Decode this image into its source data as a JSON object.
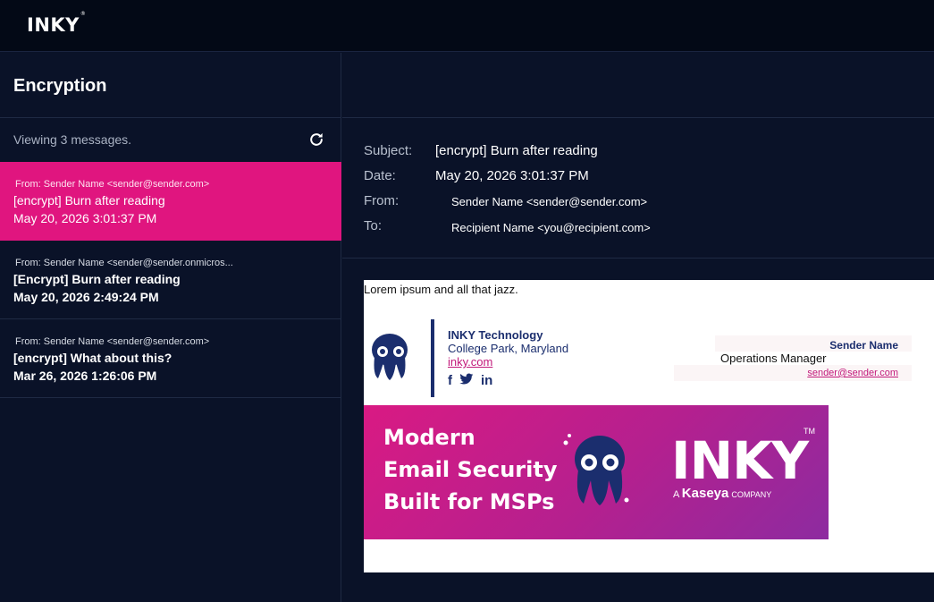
{
  "app": {
    "logo": "INKY",
    "logo_mark": "®"
  },
  "sidebar": {
    "title": "Encryption",
    "viewing_text": "Viewing 3 messages.",
    "refresh_icon": "refresh-icon",
    "messages": [
      {
        "from": "From: Sender Name <sender@sender.com>",
        "subject": "[encrypt] Burn after reading",
        "date": "May 20, 2026 3:01:37 PM",
        "selected": true
      },
      {
        "from": "From: Sender Name <sender@sender.onmicros...",
        "subject": "[Encrypt] Burn after reading",
        "date": "May 20, 2026 2:49:24 PM",
        "selected": false
      },
      {
        "from": "From: Sender Name <sender@sender.com>",
        "subject": "[encrypt] What about this?",
        "date": "Mar 26, 2026 1:26:06 PM",
        "selected": false
      }
    ]
  },
  "detail": {
    "subject_label": "Subject:",
    "subject": "[encrypt] Burn after reading",
    "date_label": "Date:",
    "date": "May 20, 2026 3:01:37 PM",
    "from_label": "From:",
    "from": "Sender Name <sender@sender.com>",
    "to_label": "To:",
    "to": "Recipient Name <you@recipient.com>"
  },
  "email": {
    "body": "Lorem ipsum and all that jazz.",
    "signature": {
      "company": "INKY Technology",
      "city": "College Park, Maryland",
      "link": "inky.com",
      "social": [
        "f",
        "t",
        "in"
      ],
      "name": "Sender Name",
      "title": "Operations Manager",
      "email": "sender@sender.com"
    },
    "banner": {
      "line1": "Modern",
      "line2": "Email Security",
      "line3": "Built for MSPs",
      "brand": "INKY",
      "tm": "TM",
      "sub_a": "A",
      "sub_kaseya": "Kaseya",
      "sub_company": "COMPANY"
    }
  },
  "colors": {
    "accent": "#e0157f",
    "background": "#0a1228",
    "navy": "#1b2e6e"
  }
}
